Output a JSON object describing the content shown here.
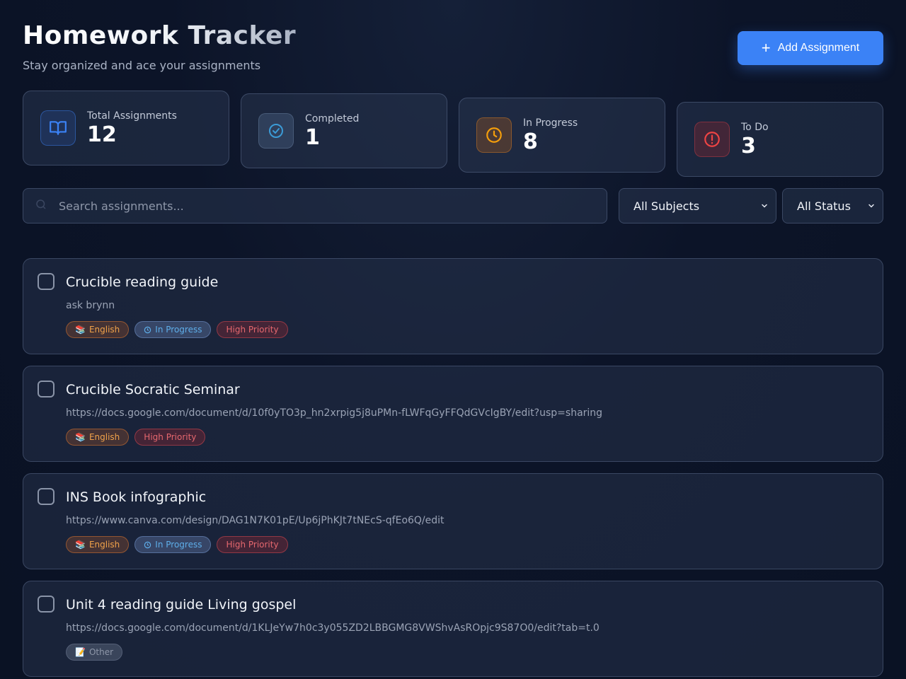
{
  "header": {
    "title": "Homework Tracker",
    "subtitle": "Stay organized and ace your assignments",
    "add_button_label": "Add Assignment"
  },
  "stats": [
    {
      "label": "Total Assignments",
      "value": "12",
      "icon": "book-icon",
      "color": "#3b82f6"
    },
    {
      "label": "Completed",
      "value": "1",
      "icon": "check-circle-icon",
      "color": "#3b9bd6"
    },
    {
      "label": "In Progress",
      "value": "8",
      "icon": "clock-icon",
      "color": "#f59e0b"
    },
    {
      "label": "To Do",
      "value": "3",
      "icon": "alert-circle-icon",
      "color": "#ef4444"
    }
  ],
  "filters": {
    "search_placeholder": "Search assignments...",
    "subject_selected": "All Subjects",
    "status_selected": "All Status"
  },
  "assignments": [
    {
      "title": "Crucible reading guide",
      "description": "ask brynn",
      "subject": "English",
      "subject_emoji": "📚",
      "status": "In Progress",
      "priority": "High Priority"
    },
    {
      "title": "Crucible Socratic Seminar",
      "description": "https://docs.google.com/document/d/10f0yTO3p_hn2xrpig5j8uPMn-fLWFqGyFFQdGVcIgBY/edit?usp=sharing",
      "subject": "English",
      "subject_emoji": "📚",
      "priority": "High Priority"
    },
    {
      "title": "INS Book infographic",
      "description": "https://www.canva.com/design/DAG1N7K01pE/Up6jPhKJt7tNEcS-qfEo6Q/edit",
      "subject": "English",
      "subject_emoji": "📚",
      "status": "In Progress",
      "priority": "High Priority"
    },
    {
      "title": "Unit 4 reading guide Living gospel",
      "description": "https://docs.google.com/document/d/1KLJeYw7h0c3y055ZD2LBBGMG8VWShvAsROpjc9S87O0/edit?tab=t.0",
      "subject": "Other",
      "subject_emoji": "📝"
    }
  ],
  "colors": {
    "accent": "#3b82f6",
    "english": "#f0a24a",
    "in_progress": "#5eaeea",
    "high_priority": "#e5676e"
  }
}
